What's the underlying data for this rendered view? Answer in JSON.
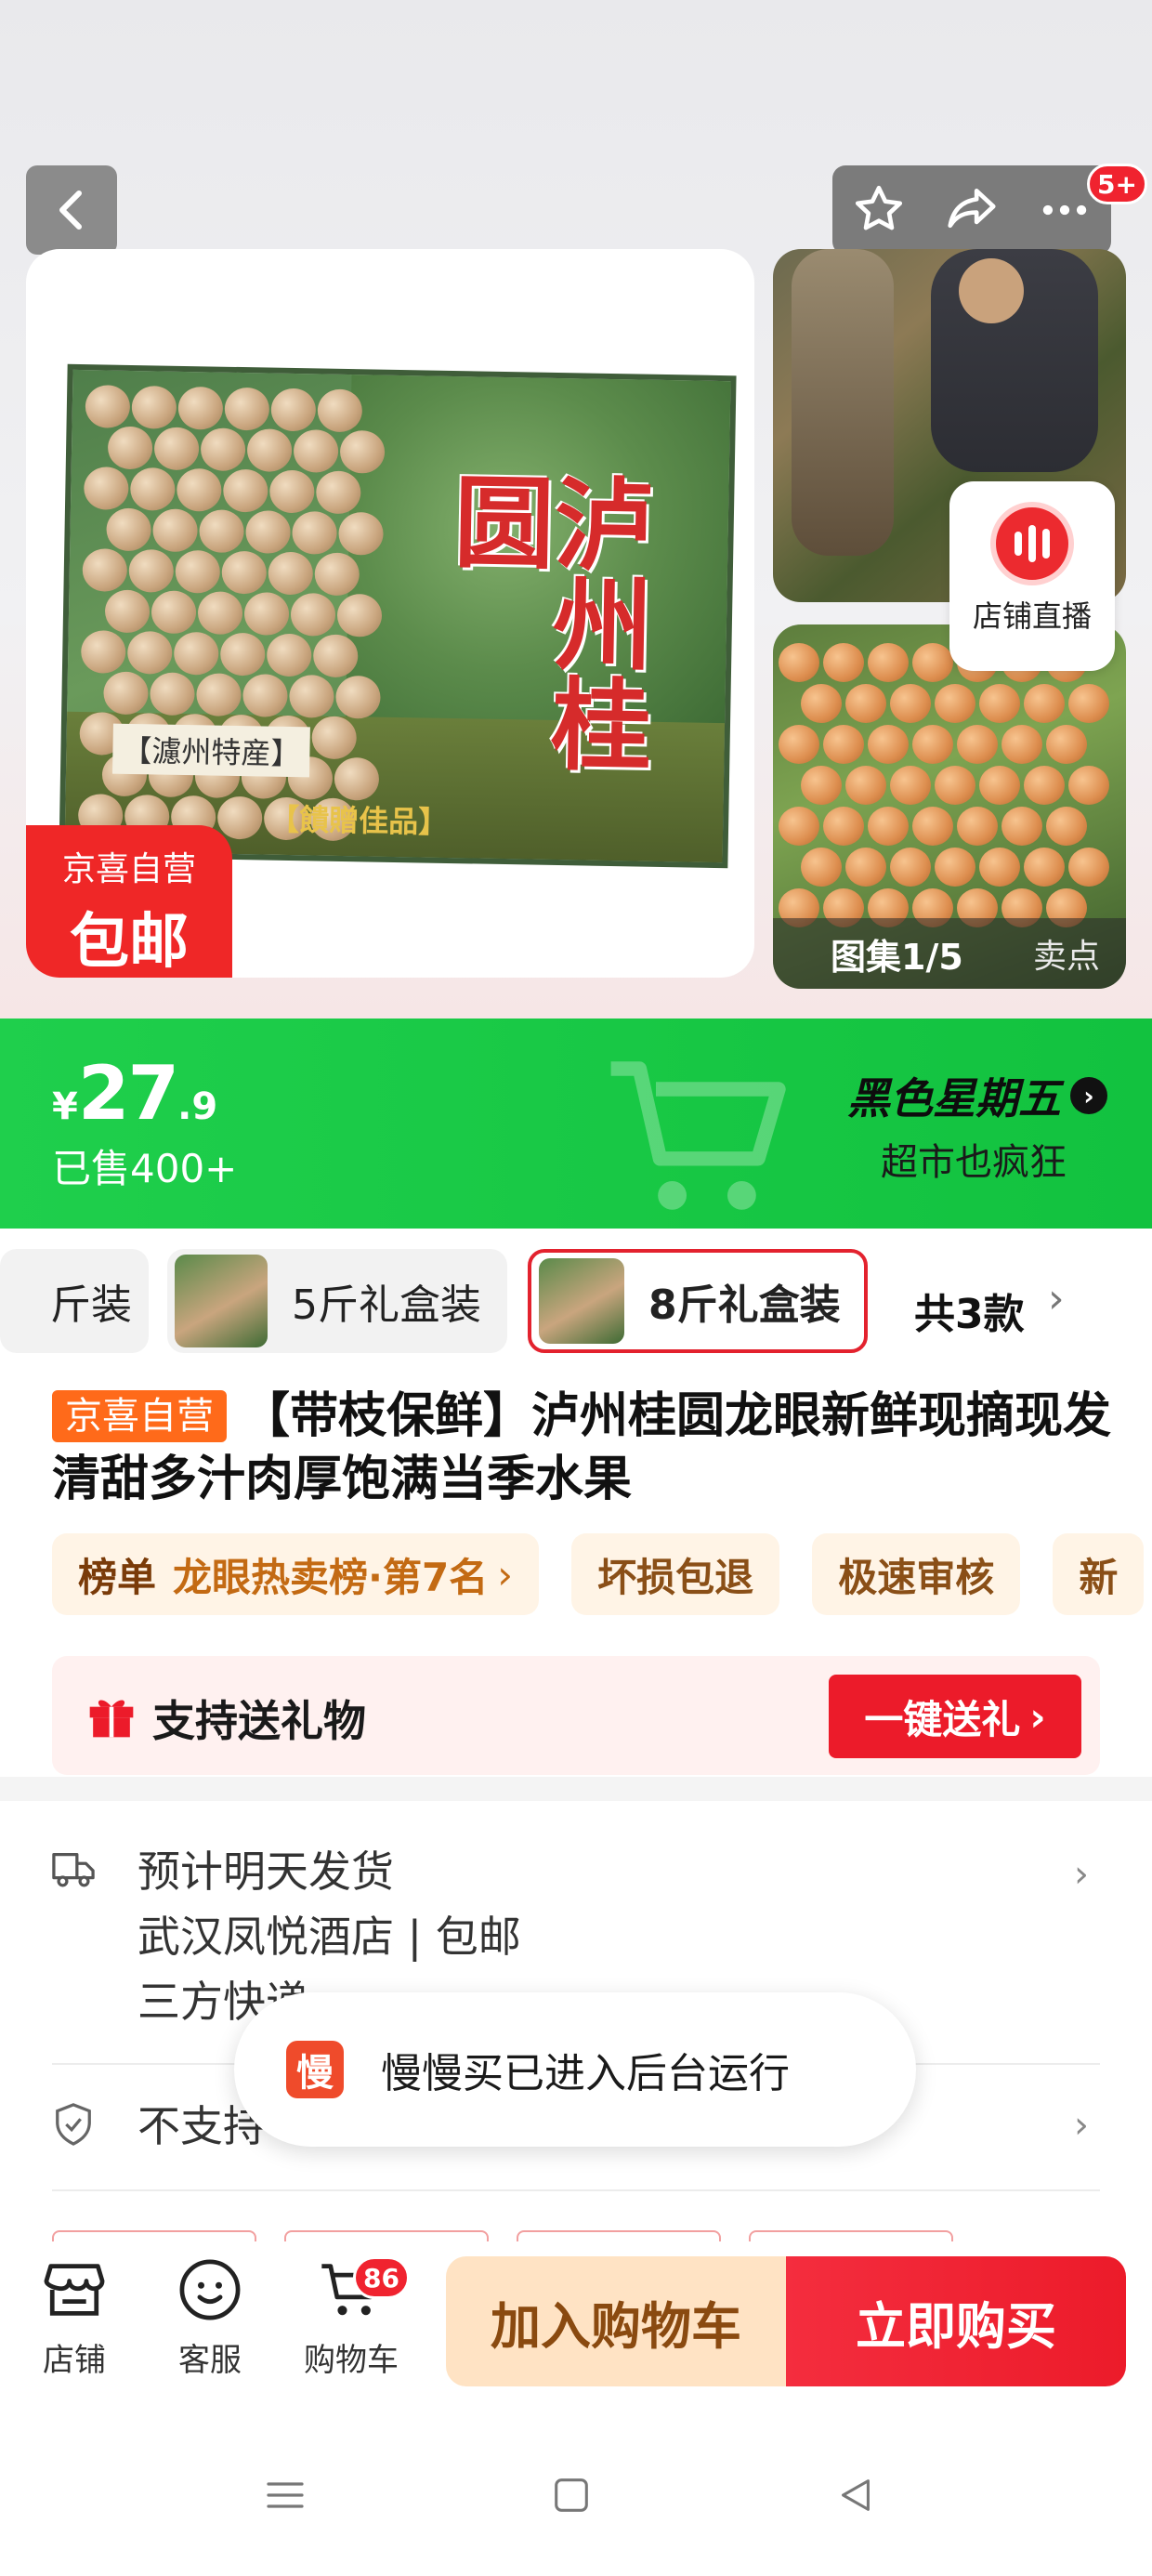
{
  "gallery": {
    "main_image": {
      "box_title": "泸州桂圆",
      "box_tag_origin": "【濾州特産】",
      "box_tag_gift": "【饋贈佳品】"
    },
    "promo_badge": {
      "line1": "京喜自营",
      "line2": "包邮"
    },
    "counter": {
      "label": "图集1/5",
      "selling_points": "卖点"
    },
    "live": {
      "label": "店铺直播"
    },
    "notification_badge": "5+"
  },
  "price": {
    "currency": "¥",
    "integer": "27",
    "decimal": ".9",
    "sold": "已售400+",
    "promo_title": "黑色星期五",
    "promo_sub": "超市也疯狂",
    "accent_color": "#1fcf4c"
  },
  "variants": {
    "items": [
      {
        "label": "斤装",
        "selected": false
      },
      {
        "label": "5斤礼盒装",
        "selected": false
      },
      {
        "label": "8斤礼盒装",
        "selected": true
      }
    ],
    "total": "共3款"
  },
  "product": {
    "tag": "京喜自营",
    "title": "【带枝保鲜】泸州桂圆龙眼新鲜现摘现发清甜多汁肉厚饱满当季水果"
  },
  "chips": {
    "rank_key": "榜单",
    "rank_value": "龙眼热卖榜·第7名",
    "items": [
      "坏损包退",
      "极速审核",
      "新"
    ]
  },
  "gift": {
    "label": "支持送礼物",
    "button": "一键送礼"
  },
  "delivery": {
    "line1": "预计明天发货",
    "line2": "武汉凤悦酒店 | 包邮",
    "line3": "三方快递",
    "returns": "不支持"
  },
  "toast": {
    "logo": "慢",
    "text": "慢慢买已进入后台运行"
  },
  "bottom_bar": {
    "store": "店铺",
    "service": "客服",
    "cart": "购物车",
    "cart_count": "86",
    "add_to_cart": "加入购物车",
    "buy_now": "立即购买",
    "buy_color": "#ec1b2a"
  }
}
